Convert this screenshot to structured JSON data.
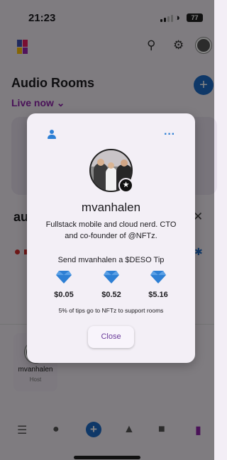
{
  "status_bar": {
    "time": "21:23",
    "battery": "77"
  },
  "header": {
    "title": "Audio Rooms",
    "filter": "Live now"
  },
  "room": {
    "title_fragment": "au"
  },
  "host_card": {
    "name": "mvanhalen",
    "role": "Host"
  },
  "bottom_nav": {
    "items": [
      "feed-icon",
      "profile-icon",
      "add-icon",
      "notifications-icon",
      "messages-icon",
      "microphone-icon"
    ]
  },
  "modal": {
    "username": "mvanhalen",
    "bio": "Fullstack mobile and cloud nerd. CTO and co-founder of @NFTz.",
    "tip_title": "Send mvanhalen a $DESO Tip",
    "tips": [
      {
        "amount": "$0.05"
      },
      {
        "amount": "$0.52"
      },
      {
        "amount": "$5.16"
      }
    ],
    "note": "5% of tips go to NFTz to support rooms",
    "close_label": "Close"
  },
  "colors": {
    "accent": "#2d7fd4",
    "live": "#8e24aa",
    "close_text": "#6a3a9a"
  }
}
